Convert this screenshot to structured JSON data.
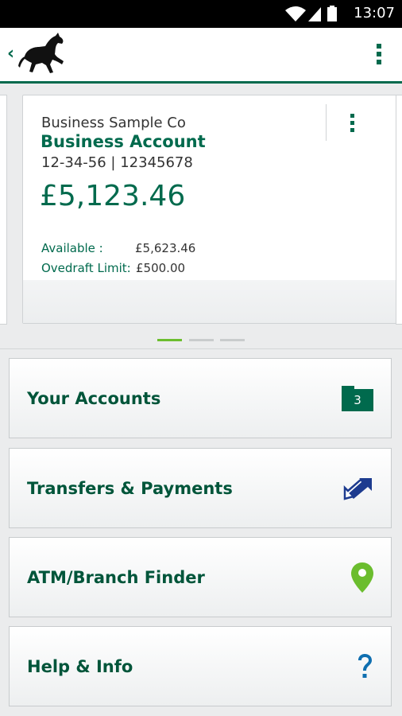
{
  "status_bar": {
    "time": "13:07"
  },
  "header": {
    "back_icon": "chevron-left-icon",
    "logo": "black-horse-logo",
    "menu_icon": "vertical-dots-icon"
  },
  "account_card": {
    "business_name": "Business Sample Co",
    "account_type": "Business Account",
    "account_numbers": "12-34-56 | 12345678",
    "balance": "£5,123.46",
    "available_label": "Available :",
    "available_value": "£5,623.46",
    "overdraft_label": "Ovedraft Limit:",
    "overdraft_value": "£500.00"
  },
  "carousel": {
    "pages": 3,
    "active_page": 1
  },
  "menu": {
    "your_accounts": {
      "label": "Your Accounts",
      "badge": "3",
      "icon": "folder-icon"
    },
    "transfers": {
      "label": "Transfers & Payments",
      "icon": "transfer-arrows-icon"
    },
    "atm_finder": {
      "label": "ATM/Branch Finder",
      "icon": "map-pin-icon"
    },
    "help": {
      "label": "Help & Info",
      "icon": "question-icon"
    }
  },
  "colors": {
    "brand_green": "#006a4d",
    "accent_green": "#6bbd2e",
    "navy": "#1d3b8f",
    "help_blue": "#0f6fb0"
  }
}
